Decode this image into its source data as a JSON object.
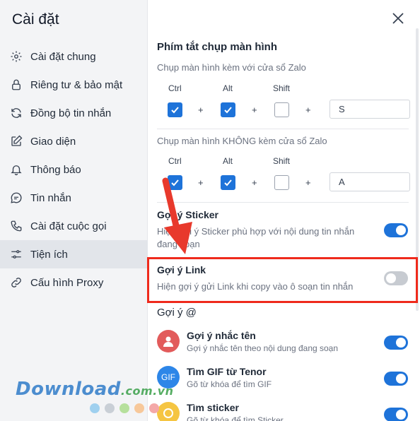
{
  "sidebar": {
    "title": "Cài đặt",
    "items": [
      {
        "label": "Cài đặt chung",
        "icon": "gear-icon"
      },
      {
        "label": "Riêng tư & bảo mật",
        "icon": "lock-icon"
      },
      {
        "label": "Đồng bộ tin nhắn",
        "icon": "sync-icon"
      },
      {
        "label": "Giao diện",
        "icon": "edit-icon"
      },
      {
        "label": "Thông báo",
        "icon": "bell-icon"
      },
      {
        "label": "Tin nhắn",
        "icon": "message-icon"
      },
      {
        "label": "Cài đặt cuộc gọi",
        "icon": "phone-icon"
      },
      {
        "label": "Tiện ích",
        "icon": "sliders-icon",
        "active": true
      },
      {
        "label": "Cấu hình Proxy",
        "icon": "proxy-icon"
      }
    ]
  },
  "main": {
    "screenshot": {
      "title": "Phím tắt chụp màn hình",
      "with_window": {
        "label": "Chụp màn hình kèm với cửa sổ Zalo",
        "keys": [
          {
            "name": "Ctrl",
            "checked": true
          },
          {
            "name": "Alt",
            "checked": true
          },
          {
            "name": "Shift",
            "checked": false
          }
        ],
        "plus": "+",
        "key_value": "S"
      },
      "without_window": {
        "label": "Chụp màn hình KHÔNG kèm cửa sổ Zalo",
        "keys": [
          {
            "name": "Ctrl",
            "checked": true
          },
          {
            "name": "Alt",
            "checked": true
          },
          {
            "name": "Shift",
            "checked": false
          }
        ],
        "plus": "+",
        "key_value": "A"
      }
    },
    "sticker": {
      "title": "Gợi ý Sticker",
      "desc_line1": "Hiện gợi ý Sticker phù hợp với nội dung tin nhắn",
      "desc_line2": "đang soạn",
      "enabled": true
    },
    "link": {
      "title": "Gợi ý Link",
      "desc": "Hiện gợi ý gửi Link khi copy vào ô soạn tin nhắn",
      "enabled": false
    },
    "mention": {
      "title": "Gợi ý @",
      "rows": [
        {
          "title": "Gợi ý nhắc tên",
          "desc": "Gợi ý nhắc tên theo nội dung đang soạn",
          "enabled": true
        },
        {
          "title": "Tìm GIF từ Tenor",
          "desc": "Gõ từ khóa để tìm GIF",
          "avatar_text": "GIF",
          "enabled": true
        },
        {
          "title": "Tìm sticker",
          "desc": "Gõ từ khóa để tìm Sticker",
          "enabled": true
        }
      ]
    }
  },
  "watermark": {
    "text": "Download",
    "domain": ".com.vn"
  },
  "colors": {
    "accent": "#1e73d9",
    "highlight": "#ef2a1c",
    "arrow": "#e8392c"
  }
}
